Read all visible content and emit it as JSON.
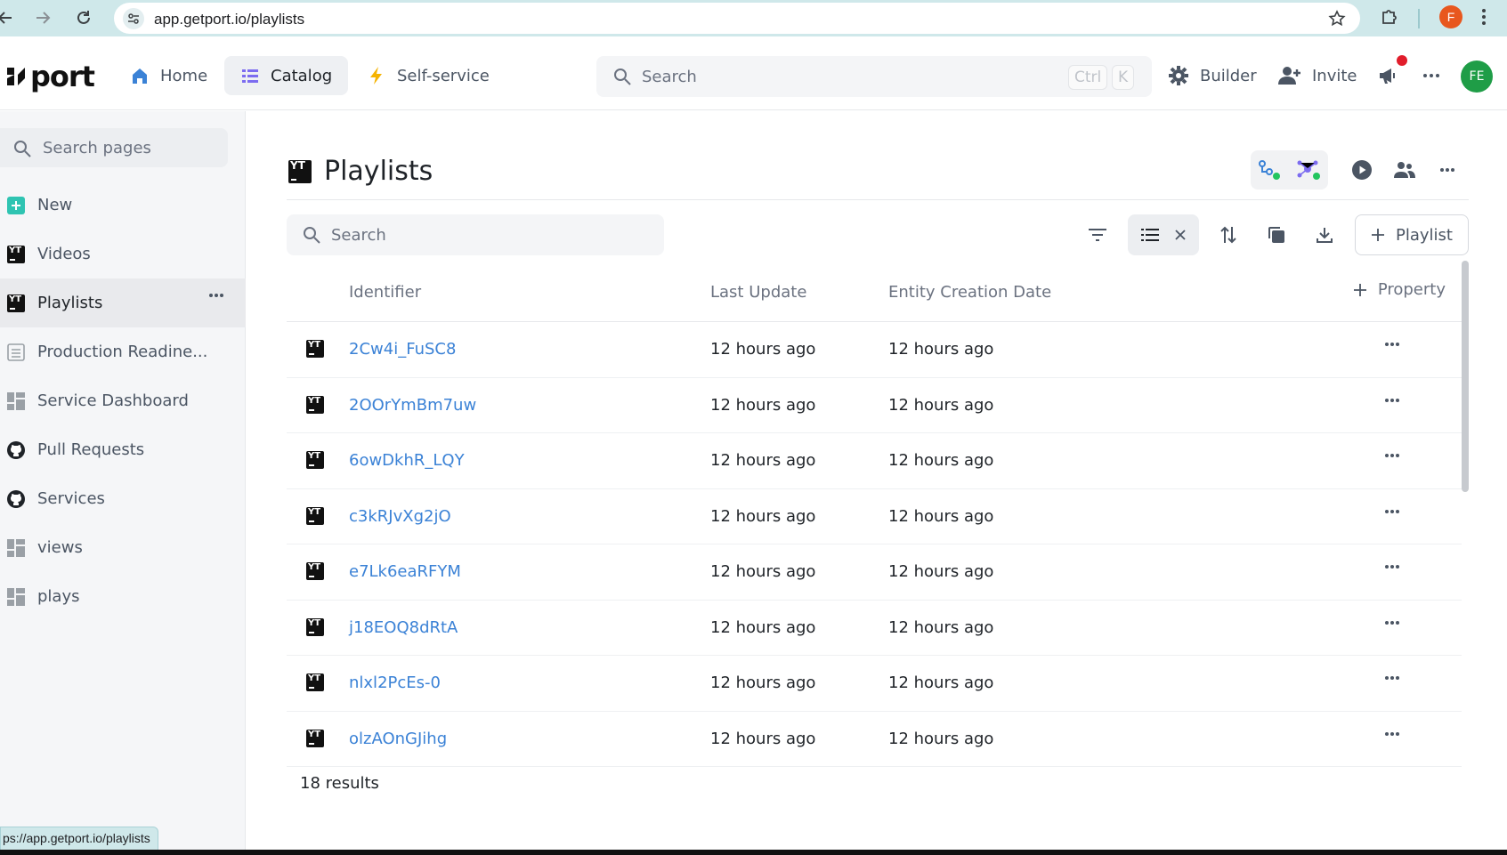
{
  "browser": {
    "url": "app.getport.io/playlists",
    "profile_initial": "F",
    "status_url": "ps://app.getport.io/playlists"
  },
  "header": {
    "logo_text": "port",
    "nav": [
      {
        "label": "Home",
        "icon": "home-icon"
      },
      {
        "label": "Catalog",
        "icon": "catalog-list-icon",
        "active": true
      },
      {
        "label": "Self-service",
        "icon": "lightning-icon"
      }
    ],
    "search_placeholder": "Search",
    "shortcut_keys": [
      "Ctrl",
      "K"
    ],
    "builder_label": "Builder",
    "invite_label": "Invite",
    "user_initials": "FE",
    "colors": {
      "accent": "#3b82d6",
      "avatar": "#1f9d47",
      "notification": "#e11d2b"
    }
  },
  "sidebar": {
    "search_placeholder": "Search pages",
    "items": [
      {
        "label": "New",
        "icon": "plus-square-icon"
      },
      {
        "label": "Videos",
        "icon": "youtube-icon"
      },
      {
        "label": "Playlists",
        "icon": "youtube-icon",
        "active": true
      },
      {
        "label": "Production Readine...",
        "icon": "scorecard-icon"
      },
      {
        "label": "Service Dashboard",
        "icon": "dashboard-icon"
      },
      {
        "label": "Pull Requests",
        "icon": "github-icon"
      },
      {
        "label": "Services",
        "icon": "github-icon"
      },
      {
        "label": "views",
        "icon": "dashboard-icon"
      },
      {
        "label": "plays",
        "icon": "dashboard-icon"
      }
    ]
  },
  "page": {
    "title": "Playlists",
    "icon_label": "YT",
    "search_placeholder": "Search",
    "add_button_label": "Playlist",
    "columns": {
      "identifier": "Identifier",
      "last_update": "Last Update",
      "created": "Entity Creation Date",
      "add_property": "Property"
    },
    "rows": [
      {
        "id": "2Cw4i_FuSC8",
        "last_update": "12 hours ago",
        "created": "12 hours ago"
      },
      {
        "id": "2OOrYmBm7uw",
        "last_update": "12 hours ago",
        "created": "12 hours ago"
      },
      {
        "id": "6owDkhR_LQY",
        "last_update": "12 hours ago",
        "created": "12 hours ago"
      },
      {
        "id": "c3kRJvXg2jO",
        "last_update": "12 hours ago",
        "created": "12 hours ago"
      },
      {
        "id": "e7Lk6eaRFYM",
        "last_update": "12 hours ago",
        "created": "12 hours ago"
      },
      {
        "id": "j18EOQ8dRtA",
        "last_update": "12 hours ago",
        "created": "12 hours ago"
      },
      {
        "id": "nlxl2PcEs-0",
        "last_update": "12 hours ago",
        "created": "12 hours ago"
      },
      {
        "id": "olzAOnGJihg",
        "last_update": "12 hours ago",
        "created": "12 hours ago"
      }
    ],
    "results_text": "18 results"
  }
}
